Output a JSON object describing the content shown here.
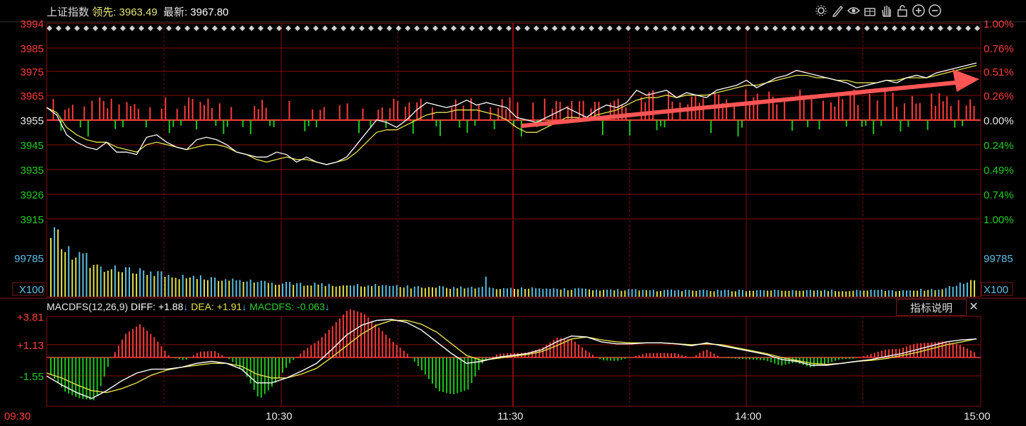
{
  "header": {
    "name": "上证指数",
    "lead_label": "领先:",
    "lead_value": "3963.49",
    "latest_label": "最新:",
    "latest_value": "3967.80"
  },
  "toolbar": [
    "gear-icon",
    "pen-icon",
    "eye-icon",
    "gift-icon",
    "hand-icon",
    "lock-icon",
    "zoom-in-icon",
    "zoom-out-icon"
  ],
  "price_axis_left": [
    {
      "v": "3994",
      "c": "#ff3b3b"
    },
    {
      "v": "3985",
      "c": "#ff3b3b"
    },
    {
      "v": "3975",
      "c": "#ff3b3b"
    },
    {
      "v": "3965",
      "c": "#ff3b3b"
    },
    {
      "v": "3955",
      "c": "#e8e8e8"
    },
    {
      "v": "3945",
      "c": "#22cc22"
    },
    {
      "v": "3935",
      "c": "#22cc22"
    },
    {
      "v": "3926",
      "c": "#22cc22"
    },
    {
      "v": "3915",
      "c": "#22cc22"
    }
  ],
  "price_axis_right": [
    {
      "v": "1.00%",
      "c": "#ff3b3b"
    },
    {
      "v": "0.76%",
      "c": "#ff3b3b"
    },
    {
      "v": "0.51%",
      "c": "#ff3b3b"
    },
    {
      "v": "0.26%",
      "c": "#ff3b3b"
    },
    {
      "v": "0.00%",
      "c": "#e8e8e8"
    },
    {
      "v": "0.24%",
      "c": "#22cc22"
    },
    {
      "v": "0.49%",
      "c": "#22cc22"
    },
    {
      "v": "0.74%",
      "c": "#22cc22"
    },
    {
      "v": "1.00%",
      "c": "#22cc22"
    }
  ],
  "volume_axis": {
    "top": "99785",
    "unit": "X100"
  },
  "macd": {
    "name": "MACDFS(12,26,9)",
    "diff_label": "DIFF:",
    "diff_value": "+1.88",
    "dea_label": "DEA:",
    "dea_value": "+1.91",
    "macd_label": "MACDFS:",
    "macd_value": "-0.063",
    "arrow": "↓",
    "axis": [
      {
        "v": "+3.81",
        "c": "#ff3b3b"
      },
      {
        "v": "+1.13",
        "c": "#ff3b3b"
      },
      {
        "v": "-1.55",
        "c": "#22cc22"
      }
    ],
    "explain_label": "指标说明",
    "close_glyph": "✕"
  },
  "time_axis": [
    "09:30",
    "10:30",
    "11:30",
    "14:00",
    "15:00"
  ],
  "colors": {
    "up": "#ff3b3b",
    "down": "#1fc81f",
    "grid": "#8a0c0c",
    "price": "#ffffff",
    "avg": "#e6e24a",
    "vol": "#5bc0e6",
    "trend": "#ff5555"
  },
  "chart_data": {
    "type": "line",
    "title": "上证指数",
    "ylim": [
      3915,
      3994
    ],
    "prev_close": 3955,
    "price": [
      3960,
      3957,
      3949,
      3946,
      3944,
      3943,
      3946,
      3942,
      3942,
      3941,
      3948,
      3949,
      3946,
      3944,
      3943,
      3947,
      3948,
      3947,
      3945,
      3942,
      3941,
      3940,
      3940,
      3942,
      3941,
      3938,
      3940,
      3938,
      3937,
      3938,
      3940,
      3945,
      3950,
      3955,
      3954,
      3952,
      3955,
      3959,
      3962,
      3961,
      3960,
      3961,
      3963,
      3961,
      3962,
      3961,
      3960,
      3956,
      3955,
      3954,
      3956,
      3958,
      3960,
      3958,
      3956,
      3959,
      3961,
      3960,
      3962,
      3967,
      3965,
      3966,
      3967,
      3964,
      3966,
      3965,
      3964,
      3967,
      3968,
      3969,
      3971,
      3968,
      3970,
      3972,
      3973,
      3975,
      3974,
      3973,
      3972,
      3971,
      3970,
      3968,
      3969,
      3970,
      3971,
      3970,
      3972,
      3973,
      3972,
      3974,
      3975,
      3976,
      3977,
      3978
    ],
    "avg": [
      3960,
      3958,
      3952,
      3949,
      3947,
      3946,
      3946,
      3944,
      3943,
      3942,
      3945,
      3946,
      3945,
      3944,
      3943,
      3944,
      3945,
      3945,
      3944,
      3942,
      3941,
      3939,
      3938,
      3939,
      3940,
      3939,
      3939,
      3938,
      3937,
      3938,
      3939,
      3942,
      3946,
      3950,
      3951,
      3951,
      3953,
      3955,
      3957,
      3958,
      3958,
      3959,
      3959,
      3959,
      3958,
      3957,
      3955,
      3952,
      3950,
      3950,
      3952,
      3954,
      3956,
      3956,
      3955,
      3957,
      3958,
      3959,
      3961,
      3963,
      3964,
      3964,
      3965,
      3964,
      3965,
      3965,
      3965,
      3966,
      3967,
      3968,
      3969,
      3969,
      3970,
      3971,
      3972,
      3973,
      3973,
      3972,
      3972,
      3971,
      3971,
      3970,
      3970,
      3970,
      3971,
      3971,
      3972,
      3972,
      3972,
      3973,
      3974,
      3975,
      3976,
      3977
    ],
    "volume": [
      100,
      72,
      60,
      55,
      48,
      42,
      40,
      38,
      37,
      36,
      35,
      33,
      30,
      29,
      28,
      27,
      26,
      25,
      24,
      23,
      22,
      21,
      20,
      20,
      19,
      19,
      18,
      18,
      17,
      17,
      17,
      16,
      16,
      16,
      15,
      15,
      15,
      14,
      14,
      14,
      14,
      13,
      13,
      13,
      13,
      12,
      12,
      12,
      12,
      12,
      11,
      11,
      11,
      11,
      11,
      11,
      10,
      10,
      10,
      10,
      10,
      10,
      9,
      9,
      9,
      9,
      9,
      9,
      9,
      9,
      9,
      9,
      9,
      9,
      9,
      9,
      9,
      9,
      9,
      9,
      9,
      9,
      9,
      9,
      9,
      9,
      9,
      9,
      9,
      9,
      10,
      10,
      12,
      14,
      18,
      28
    ],
    "macd_diff": [
      -1.9,
      -2.8,
      -3.6,
      -4.2,
      -3.4,
      -2.4,
      -1.6,
      -1.2,
      -1.2,
      -1.0,
      -0.6,
      -0.4,
      -0.6,
      -1.2,
      -2.6,
      -2.6,
      -2.1,
      -1.4,
      -0.6,
      0.8,
      2.3,
      3.3,
      3.8,
      3.9,
      3.6,
      2.8,
      1.6,
      0.4,
      -0.6,
      -0.4,
      0.0,
      0.2,
      0.4,
      0.8,
      1.6,
      2.2,
      2.1,
      1.6,
      1.4,
      1.4,
      1.5,
      1.5,
      1.4,
      1.2,
      1.5,
      1.2,
      0.9,
      0.6,
      0.3,
      -0.2,
      -0.4,
      -0.8,
      -0.8,
      -0.6,
      -0.4,
      -0.2,
      0.1,
      0.4,
      0.8,
      1.2,
      1.6,
      1.8,
      1.9
    ],
    "macd_dea": [
      -1.6,
      -2.1,
      -2.8,
      -3.4,
      -3.6,
      -3.2,
      -2.6,
      -1.8,
      -1.3,
      -1.0,
      -0.8,
      -0.6,
      -0.6,
      -0.9,
      -1.7,
      -2.1,
      -2.1,
      -1.7,
      -1.1,
      0.0,
      1.2,
      2.4,
      3.3,
      3.8,
      3.8,
      3.4,
      2.6,
      1.4,
      0.2,
      -0.3,
      -0.1,
      0.1,
      0.3,
      0.6,
      1.2,
      1.9,
      2.1,
      1.8,
      1.6,
      1.5,
      1.5,
      1.5,
      1.4,
      1.3,
      1.4,
      1.3,
      1.0,
      0.7,
      0.4,
      0.0,
      -0.3,
      -0.6,
      -0.7,
      -0.6,
      -0.4,
      -0.3,
      -0.1,
      0.2,
      0.5,
      0.9,
      1.3,
      1.6,
      1.91
    ]
  }
}
